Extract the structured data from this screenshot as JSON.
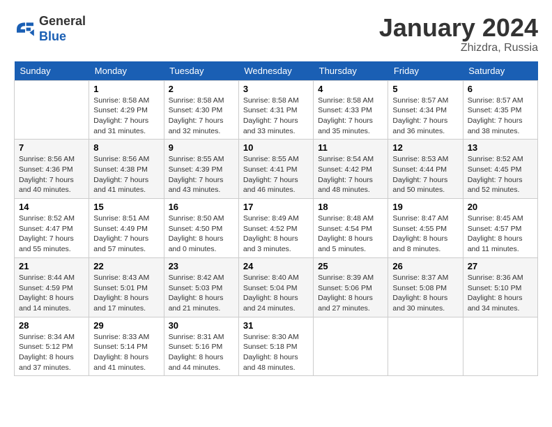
{
  "header": {
    "logo": {
      "line1": "General",
      "line2": "Blue"
    },
    "title": "January 2024",
    "subtitle": "Zhizdra, Russia"
  },
  "days_of_week": [
    "Sunday",
    "Monday",
    "Tuesday",
    "Wednesday",
    "Thursday",
    "Friday",
    "Saturday"
  ],
  "weeks": [
    [
      {
        "day": "",
        "sunrise": "",
        "sunset": "",
        "daylight": ""
      },
      {
        "day": "1",
        "sunrise": "Sunrise: 8:58 AM",
        "sunset": "Sunset: 4:29 PM",
        "daylight": "Daylight: 7 hours and 31 minutes."
      },
      {
        "day": "2",
        "sunrise": "Sunrise: 8:58 AM",
        "sunset": "Sunset: 4:30 PM",
        "daylight": "Daylight: 7 hours and 32 minutes."
      },
      {
        "day": "3",
        "sunrise": "Sunrise: 8:58 AM",
        "sunset": "Sunset: 4:31 PM",
        "daylight": "Daylight: 7 hours and 33 minutes."
      },
      {
        "day": "4",
        "sunrise": "Sunrise: 8:58 AM",
        "sunset": "Sunset: 4:33 PM",
        "daylight": "Daylight: 7 hours and 35 minutes."
      },
      {
        "day": "5",
        "sunrise": "Sunrise: 8:57 AM",
        "sunset": "Sunset: 4:34 PM",
        "daylight": "Daylight: 7 hours and 36 minutes."
      },
      {
        "day": "6",
        "sunrise": "Sunrise: 8:57 AM",
        "sunset": "Sunset: 4:35 PM",
        "daylight": "Daylight: 7 hours and 38 minutes."
      }
    ],
    [
      {
        "day": "7",
        "sunrise": "Sunrise: 8:56 AM",
        "sunset": "Sunset: 4:36 PM",
        "daylight": "Daylight: 7 hours and 40 minutes."
      },
      {
        "day": "8",
        "sunrise": "Sunrise: 8:56 AM",
        "sunset": "Sunset: 4:38 PM",
        "daylight": "Daylight: 7 hours and 41 minutes."
      },
      {
        "day": "9",
        "sunrise": "Sunrise: 8:55 AM",
        "sunset": "Sunset: 4:39 PM",
        "daylight": "Daylight: 7 hours and 43 minutes."
      },
      {
        "day": "10",
        "sunrise": "Sunrise: 8:55 AM",
        "sunset": "Sunset: 4:41 PM",
        "daylight": "Daylight: 7 hours and 46 minutes."
      },
      {
        "day": "11",
        "sunrise": "Sunrise: 8:54 AM",
        "sunset": "Sunset: 4:42 PM",
        "daylight": "Daylight: 7 hours and 48 minutes."
      },
      {
        "day": "12",
        "sunrise": "Sunrise: 8:53 AM",
        "sunset": "Sunset: 4:44 PM",
        "daylight": "Daylight: 7 hours and 50 minutes."
      },
      {
        "day": "13",
        "sunrise": "Sunrise: 8:52 AM",
        "sunset": "Sunset: 4:45 PM",
        "daylight": "Daylight: 7 hours and 52 minutes."
      }
    ],
    [
      {
        "day": "14",
        "sunrise": "Sunrise: 8:52 AM",
        "sunset": "Sunset: 4:47 PM",
        "daylight": "Daylight: 7 hours and 55 minutes."
      },
      {
        "day": "15",
        "sunrise": "Sunrise: 8:51 AM",
        "sunset": "Sunset: 4:49 PM",
        "daylight": "Daylight: 7 hours and 57 minutes."
      },
      {
        "day": "16",
        "sunrise": "Sunrise: 8:50 AM",
        "sunset": "Sunset: 4:50 PM",
        "daylight": "Daylight: 8 hours and 0 minutes."
      },
      {
        "day": "17",
        "sunrise": "Sunrise: 8:49 AM",
        "sunset": "Sunset: 4:52 PM",
        "daylight": "Daylight: 8 hours and 3 minutes."
      },
      {
        "day": "18",
        "sunrise": "Sunrise: 8:48 AM",
        "sunset": "Sunset: 4:54 PM",
        "daylight": "Daylight: 8 hours and 5 minutes."
      },
      {
        "day": "19",
        "sunrise": "Sunrise: 8:47 AM",
        "sunset": "Sunset: 4:55 PM",
        "daylight": "Daylight: 8 hours and 8 minutes."
      },
      {
        "day": "20",
        "sunrise": "Sunrise: 8:45 AM",
        "sunset": "Sunset: 4:57 PM",
        "daylight": "Daylight: 8 hours and 11 minutes."
      }
    ],
    [
      {
        "day": "21",
        "sunrise": "Sunrise: 8:44 AM",
        "sunset": "Sunset: 4:59 PM",
        "daylight": "Daylight: 8 hours and 14 minutes."
      },
      {
        "day": "22",
        "sunrise": "Sunrise: 8:43 AM",
        "sunset": "Sunset: 5:01 PM",
        "daylight": "Daylight: 8 hours and 17 minutes."
      },
      {
        "day": "23",
        "sunrise": "Sunrise: 8:42 AM",
        "sunset": "Sunset: 5:03 PM",
        "daylight": "Daylight: 8 hours and 21 minutes."
      },
      {
        "day": "24",
        "sunrise": "Sunrise: 8:40 AM",
        "sunset": "Sunset: 5:04 PM",
        "daylight": "Daylight: 8 hours and 24 minutes."
      },
      {
        "day": "25",
        "sunrise": "Sunrise: 8:39 AM",
        "sunset": "Sunset: 5:06 PM",
        "daylight": "Daylight: 8 hours and 27 minutes."
      },
      {
        "day": "26",
        "sunrise": "Sunrise: 8:37 AM",
        "sunset": "Sunset: 5:08 PM",
        "daylight": "Daylight: 8 hours and 30 minutes."
      },
      {
        "day": "27",
        "sunrise": "Sunrise: 8:36 AM",
        "sunset": "Sunset: 5:10 PM",
        "daylight": "Daylight: 8 hours and 34 minutes."
      }
    ],
    [
      {
        "day": "28",
        "sunrise": "Sunrise: 8:34 AM",
        "sunset": "Sunset: 5:12 PM",
        "daylight": "Daylight: 8 hours and 37 minutes."
      },
      {
        "day": "29",
        "sunrise": "Sunrise: 8:33 AM",
        "sunset": "Sunset: 5:14 PM",
        "daylight": "Daylight: 8 hours and 41 minutes."
      },
      {
        "day": "30",
        "sunrise": "Sunrise: 8:31 AM",
        "sunset": "Sunset: 5:16 PM",
        "daylight": "Daylight: 8 hours and 44 minutes."
      },
      {
        "day": "31",
        "sunrise": "Sunrise: 8:30 AM",
        "sunset": "Sunset: 5:18 PM",
        "daylight": "Daylight: 8 hours and 48 minutes."
      },
      {
        "day": "",
        "sunrise": "",
        "sunset": "",
        "daylight": ""
      },
      {
        "day": "",
        "sunrise": "",
        "sunset": "",
        "daylight": ""
      },
      {
        "day": "",
        "sunrise": "",
        "sunset": "",
        "daylight": ""
      }
    ]
  ]
}
